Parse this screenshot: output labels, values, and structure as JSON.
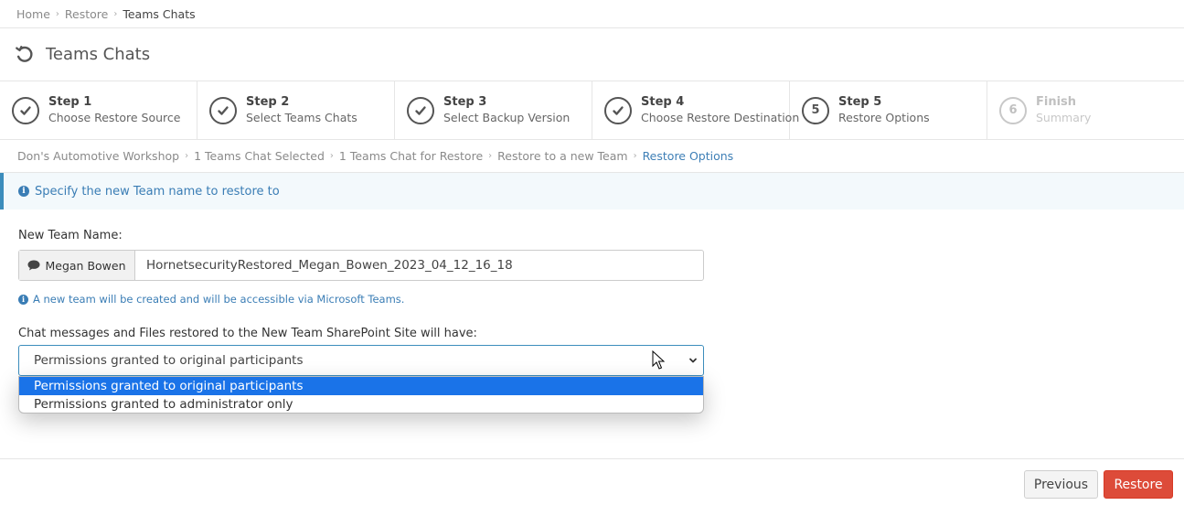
{
  "breadcrumb": [
    "Home",
    "Restore",
    "Teams Chats"
  ],
  "page_title": "Teams Chats",
  "steps": [
    {
      "title": "Step 1",
      "subtitle": "Choose Restore Source",
      "mark": "check"
    },
    {
      "title": "Step 2",
      "subtitle": "Select Teams Chats",
      "mark": "check"
    },
    {
      "title": "Step 3",
      "subtitle": "Select Backup Version",
      "mark": "check"
    },
    {
      "title": "Step 4",
      "subtitle": "Choose Restore Destination",
      "mark": "check"
    },
    {
      "title": "Step 5",
      "subtitle": "Restore Options",
      "mark": "5"
    },
    {
      "title": "Finish",
      "subtitle": "Summary",
      "mark": "6"
    }
  ],
  "sub_breadcrumb": [
    "Don's Automotive Workshop",
    "1 Teams Chat Selected",
    "1 Teams Chat for Restore",
    "Restore to a new Team",
    "Restore Options"
  ],
  "info_message": "Specify the new Team name to restore to",
  "form": {
    "team_name_label": "New Team Name:",
    "chat_owner": "Megan Bowen",
    "team_name_value": "HornetsecurityRestored_Megan_Bowen_2023_04_12_16_18",
    "team_help": "A new team will be created and will be accessible via Microsoft Teams.",
    "permissions_label": "Chat messages and Files restored to the New Team SharePoint Site will have:",
    "permissions_selected": "Permissions granted to original participants",
    "permissions_options": [
      "Permissions granted to original participants",
      "Permissions granted to administrator only"
    ]
  },
  "buttons": {
    "previous": "Previous",
    "restore": "Restore"
  },
  "colors": {
    "accent": "#3c8dbc",
    "danger": "#dd4b39",
    "option_highlight": "#1a73e8"
  },
  "icons": {
    "title": "undo-icon",
    "check": "check-icon",
    "info": "info-circle-icon",
    "chat": "comment-icon"
  }
}
